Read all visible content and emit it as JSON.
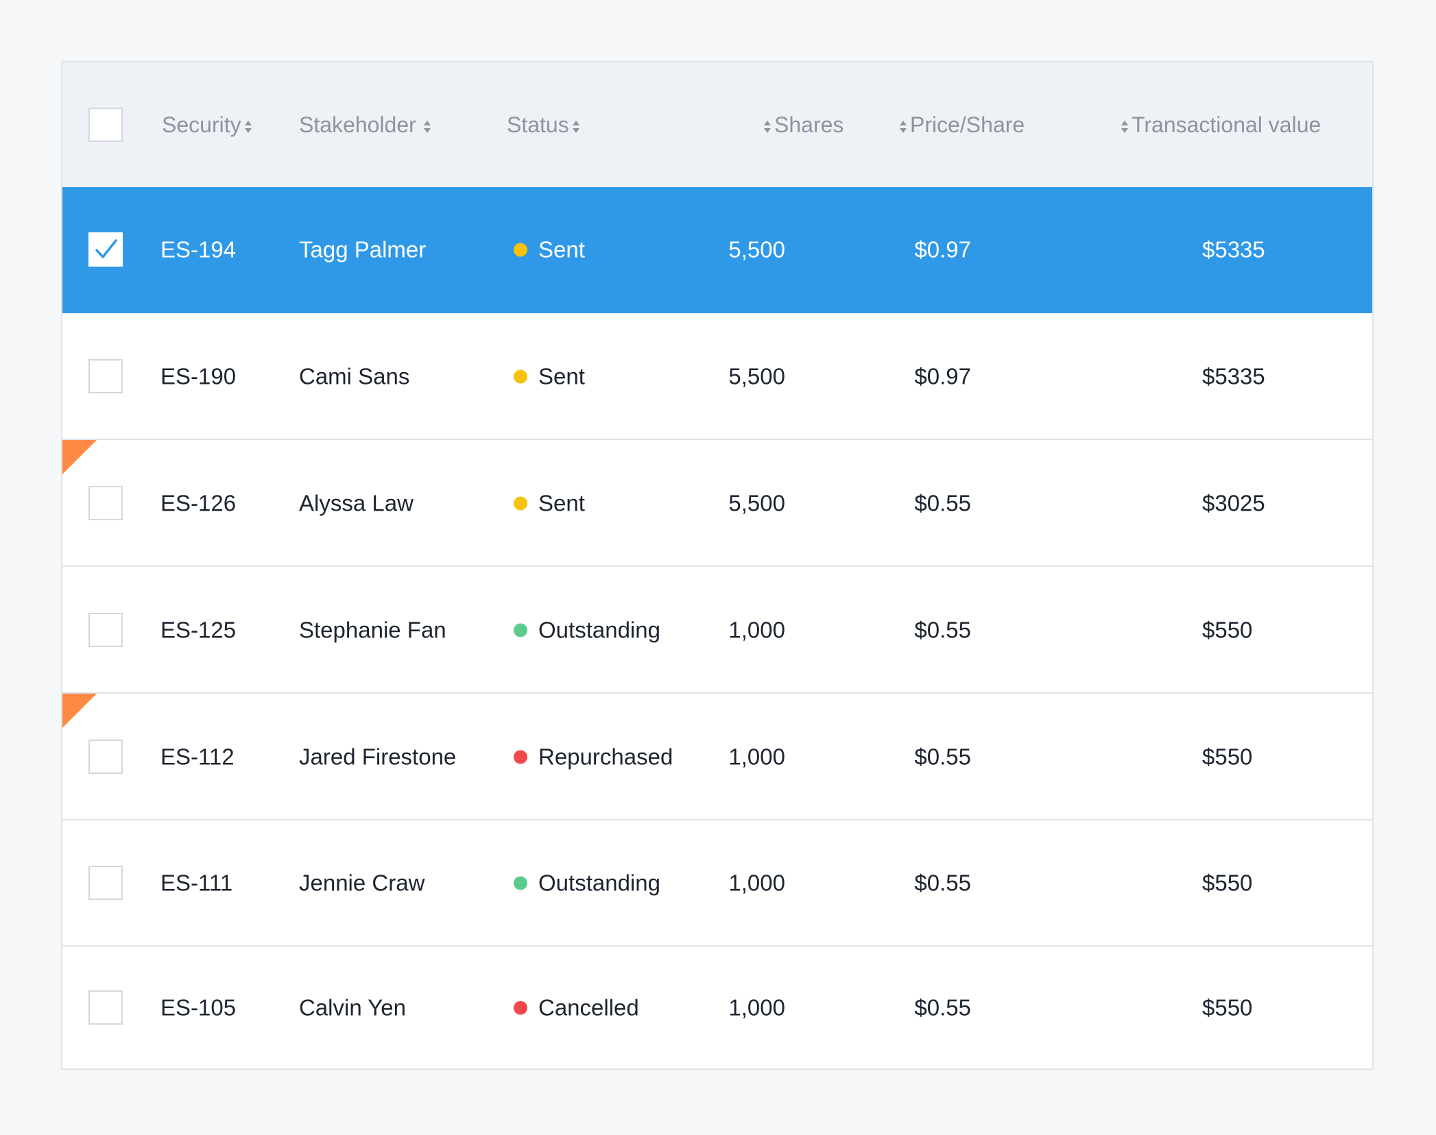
{
  "colors": {
    "selected_row": "#2f99e8",
    "status_sent": "#f8c20b",
    "status_outstanding": "#5ccb8b",
    "status_repurchased": "#f2474d",
    "status_cancelled": "#f2474d",
    "flag": "#ff8a45"
  },
  "header": {
    "security": "Security",
    "stakeholder": "Stakeholder",
    "status": "Status",
    "shares": "Shares",
    "price_per_share": "Price/Share",
    "transactional_value": "Transactional value"
  },
  "rows": [
    {
      "security": "ES-194",
      "stakeholder": "Tagg Palmer",
      "status": "Sent",
      "shares": "5,500",
      "price": "$0.97",
      "value": "$5335",
      "selected": true,
      "flagged": false
    },
    {
      "security": "ES-190",
      "stakeholder": "Cami Sans",
      "status": "Sent",
      "shares": "5,500",
      "price": "$0.97",
      "value": "$5335",
      "selected": false,
      "flagged": false
    },
    {
      "security": "ES-126",
      "stakeholder": "Alyssa Law",
      "status": "Sent",
      "shares": "5,500",
      "price": "$0.55",
      "value": "$3025",
      "selected": false,
      "flagged": true
    },
    {
      "security": "ES-125",
      "stakeholder": "Stephanie Fan",
      "status": "Outstanding",
      "shares": "1,000",
      "price": "$0.55",
      "value": "$550",
      "selected": false,
      "flagged": false
    },
    {
      "security": "ES-112",
      "stakeholder": "Jared Firestone",
      "status": "Repurchased",
      "shares": "1,000",
      "price": "$0.55",
      "value": "$550",
      "selected": false,
      "flagged": true
    },
    {
      "security": "ES-111",
      "stakeholder": "Jennie Craw",
      "status": "Outstanding",
      "shares": "1,000",
      "price": "$0.55",
      "value": "$550",
      "selected": false,
      "flagged": false
    },
    {
      "security": "ES-105",
      "stakeholder": "Calvin Yen",
      "status": "Cancelled",
      "shares": "1,000",
      "price": "$0.55",
      "value": "$550",
      "selected": false,
      "flagged": false
    }
  ]
}
